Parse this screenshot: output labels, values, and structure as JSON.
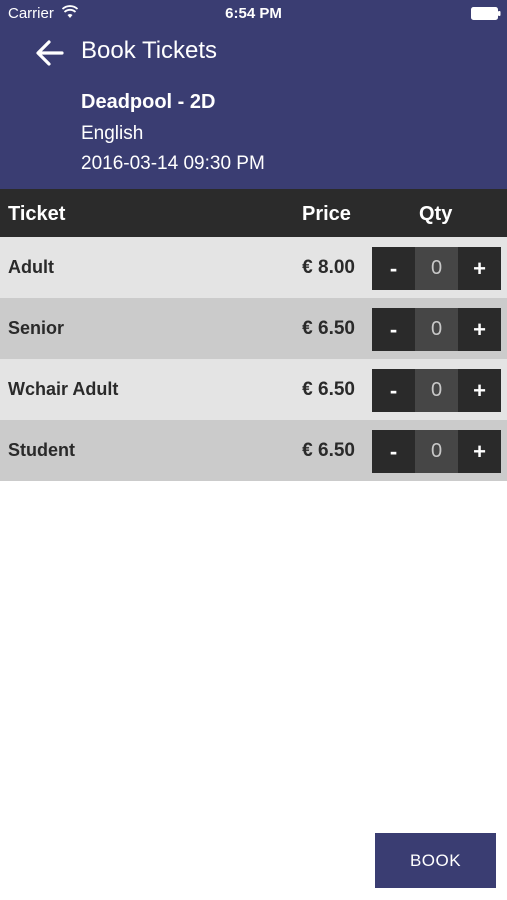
{
  "status_bar": {
    "carrier": "Carrier",
    "time": "6:54 PM",
    "wifi_icon": "wifi-icon",
    "battery_icon": "battery-icon"
  },
  "header": {
    "back_icon": "arrow-left-icon",
    "title": "Book Tickets",
    "movie": {
      "name": "Deadpool - 2D",
      "language": "English",
      "datetime": "2016-03-14 09:30 PM"
    },
    "background_color": "#3a3d72"
  },
  "table": {
    "headers": {
      "ticket": "Ticket",
      "price": "Price",
      "qty": "Qty"
    },
    "rows": [
      {
        "label": "Adult",
        "price": "€ 8.00",
        "minus": "-",
        "qty": "0",
        "plus": "+"
      },
      {
        "label": "Senior",
        "price": "€ 6.50",
        "minus": "-",
        "qty": "0",
        "plus": "+"
      },
      {
        "label": "Wchair Adult",
        "price": "€ 6.50",
        "minus": "-",
        "qty": "0",
        "plus": "+"
      },
      {
        "label": "Student",
        "price": "€ 6.50",
        "minus": "-",
        "qty": "0",
        "plus": "+"
      }
    ]
  },
  "book_button": {
    "label": "BOOK",
    "color": "#3a3d72"
  }
}
